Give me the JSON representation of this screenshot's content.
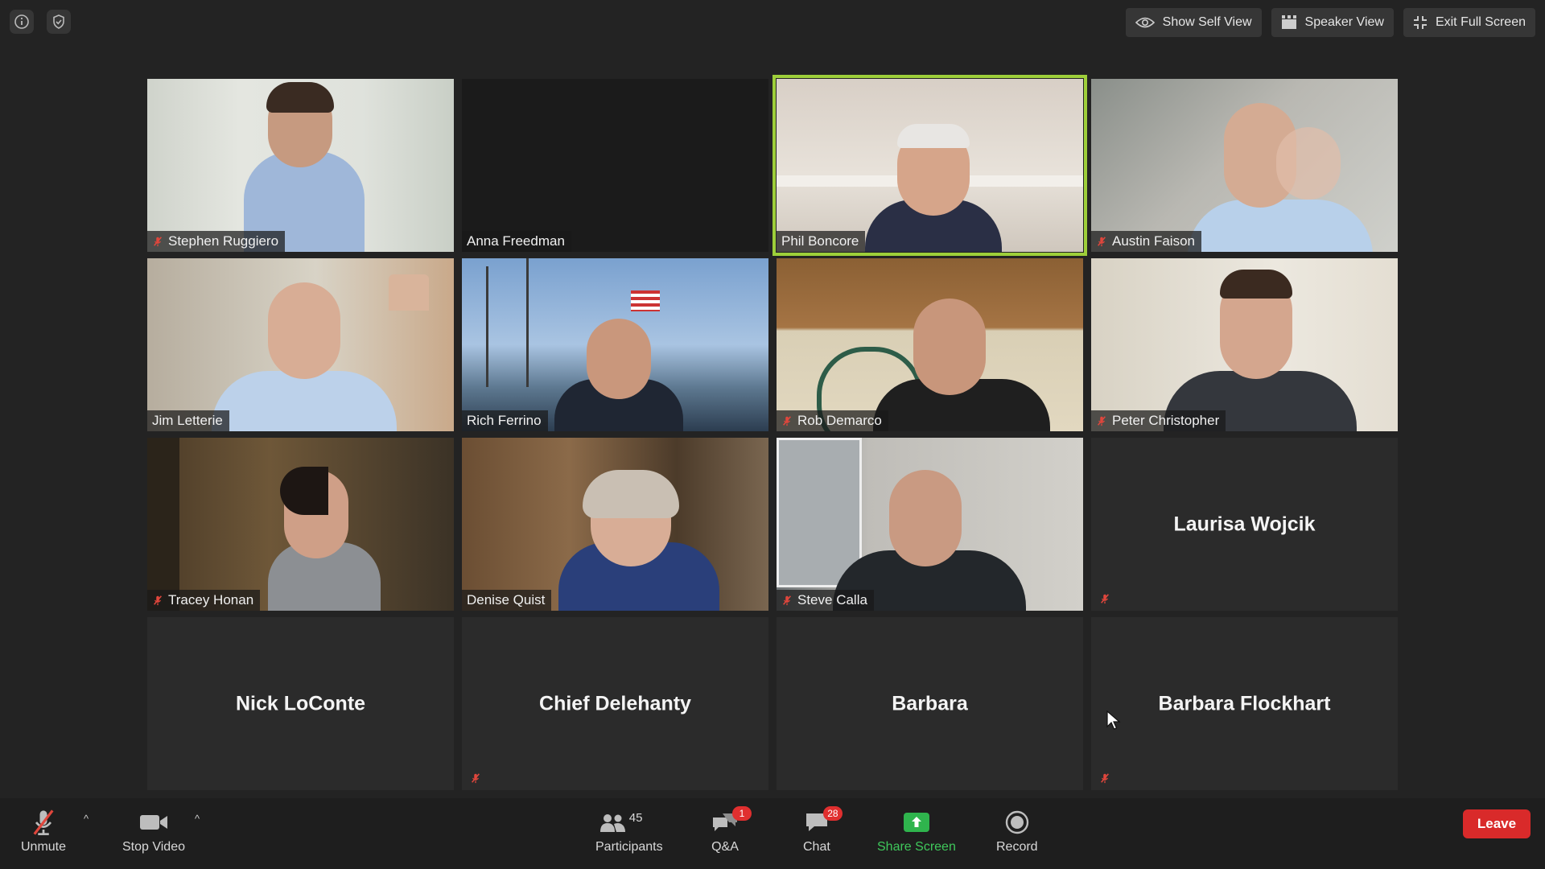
{
  "top_bar": {
    "show_self_view": "Show Self View",
    "speaker_view": "Speaker View",
    "exit_full_screen": "Exit Full Screen"
  },
  "participants": [
    {
      "name": "Stephen Ruggiero",
      "muted": true,
      "video": true
    },
    {
      "name": "Anna Freedman",
      "muted": false,
      "video": true
    },
    {
      "name": "Phil Boncore",
      "muted": false,
      "video": true,
      "active_speaker": true
    },
    {
      "name": "Austin Faison",
      "muted": true,
      "video": true
    },
    {
      "name": "Jim Letterie",
      "muted": false,
      "video": true
    },
    {
      "name": "Rich Ferrino",
      "muted": false,
      "video": true
    },
    {
      "name": "Rob Demarco",
      "muted": true,
      "video": true
    },
    {
      "name": "Peter Christopher",
      "muted": true,
      "video": true
    },
    {
      "name": "Tracey Honan",
      "muted": true,
      "video": true
    },
    {
      "name": "Denise Quist",
      "muted": false,
      "video": true
    },
    {
      "name": "Steve Calla",
      "muted": true,
      "video": true
    },
    {
      "name": "Laurisa Wojcik",
      "muted": true,
      "video": false
    },
    {
      "name": "Nick LoConte",
      "muted": false,
      "video": false
    },
    {
      "name": "Chief Delehanty",
      "muted": true,
      "video": false
    },
    {
      "name": "Barbara",
      "muted": false,
      "video": false
    },
    {
      "name": "Barbara Flockhart",
      "muted": true,
      "video": false
    }
  ],
  "toolbar": {
    "unmute": "Unmute",
    "stop_video": "Stop Video",
    "participants": "Participants",
    "participants_count": "45",
    "qa": "Q&A",
    "qa_badge": "1",
    "chat": "Chat",
    "chat_badge": "28",
    "share_screen": "Share Screen",
    "record": "Record",
    "leave": "Leave"
  },
  "colors": {
    "active_speaker_border": "#9ecf3a",
    "leave_button": "#d92a2a",
    "share_screen": "#3fc85b",
    "badge": "#e02f2f",
    "muted_icon": "#e0463c"
  }
}
